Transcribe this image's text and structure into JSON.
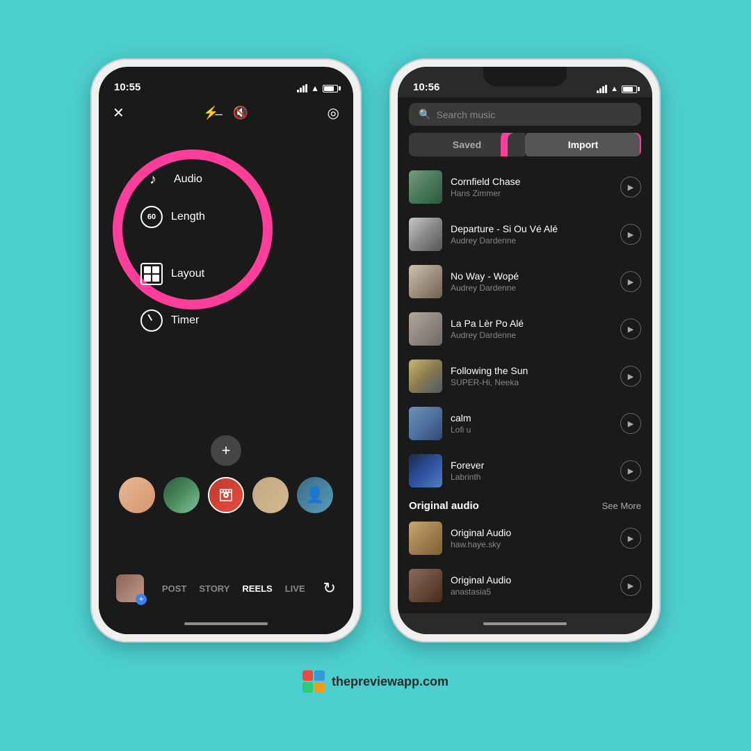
{
  "background": "#4dcfcf",
  "phone1": {
    "time": "10:55",
    "menu": {
      "audio_label": "Audio",
      "length_label": "Length",
      "length_num": "60",
      "layout_label": "Layout",
      "timer_label": "Timer"
    },
    "nav": {
      "post": "POST",
      "story": "STORY",
      "reels": "REELS",
      "live": "LIVE"
    }
  },
  "phone2": {
    "time": "10:56",
    "search_placeholder": "Search music",
    "tabs": {
      "saved": "Saved",
      "import": "Import"
    },
    "tracks": [
      {
        "title": "Cornfield Chase",
        "artist": "Hans Zimmer",
        "art": "cornfield"
      },
      {
        "title": "Departure - Si Ou Vé Alé",
        "artist": "Audrey Dardenne",
        "art": "departure"
      },
      {
        "title": "No Way - Wopé",
        "artist": "Audrey Dardenne",
        "art": "noway"
      },
      {
        "title": "La Pa Lèr Po Alé",
        "artist": "Audrey Dardenne",
        "art": "lapaler"
      },
      {
        "title": "Following the Sun",
        "artist": "SUPER-Hi, Neeka",
        "art": "sun"
      },
      {
        "title": "calm",
        "artist": "Lofi u",
        "art": "calm"
      },
      {
        "title": "Forever",
        "artist": "Labrinth",
        "art": "forever"
      }
    ],
    "original_audio_section": "Original audio",
    "see_more": "See More",
    "original_tracks": [
      {
        "title": "Original Audio",
        "artist": "haw.haye.sky",
        "art": "orig1"
      },
      {
        "title": "Original Audio",
        "artist": "anastasia5",
        "art": "orig2"
      }
    ]
  },
  "branding": {
    "website": "thepreviewapp.com"
  }
}
